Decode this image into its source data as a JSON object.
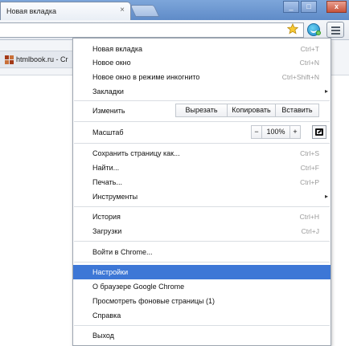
{
  "tab": {
    "title": "Новая вкладка",
    "close_glyph": "×"
  },
  "window_controls": {
    "minimize": "_",
    "maximize": "□",
    "close": "x"
  },
  "icons": {
    "star": "star-icon",
    "extension": "skype-extension-icon",
    "menu": "hamburger-menu-icon",
    "fullscreen": "fullscreen-icon",
    "submenu": "chevron-right-icon"
  },
  "bookmarks": [
    {
      "label": "htmlbook.ru - Cr"
    }
  ],
  "menu": {
    "new_tab": {
      "label": "Новая вкладка",
      "shortcut": "Ctrl+T"
    },
    "new_window": {
      "label": "Новое окно",
      "shortcut": "Ctrl+N"
    },
    "incognito": {
      "label": "Новое окно в режиме инкогнито",
      "shortcut": "Ctrl+Shift+N"
    },
    "bookmarks": {
      "label": "Закладки",
      "arrow": "▸"
    },
    "edit": {
      "label": "Изменить",
      "cut": "Вырезать",
      "copy": "Копировать",
      "paste": "Вставить"
    },
    "zoom": {
      "label": "Масштаб",
      "minus": "−",
      "value": "100%",
      "plus": "+"
    },
    "save_page": {
      "label": "Сохранить страницу как...",
      "shortcut": "Ctrl+S"
    },
    "find": {
      "label": "Найти...",
      "shortcut": "Ctrl+F"
    },
    "print": {
      "label": "Печать...",
      "shortcut": "Ctrl+P"
    },
    "tools": {
      "label": "Инструменты",
      "arrow": "▸"
    },
    "history": {
      "label": "История",
      "shortcut": "Ctrl+H"
    },
    "downloads": {
      "label": "Загрузки",
      "shortcut": "Ctrl+J"
    },
    "signin": {
      "label": "Войти в Chrome..."
    },
    "settings": {
      "label": "Настройки"
    },
    "about": {
      "label": "О браузере Google Chrome"
    },
    "background_pages": {
      "label": "Просмотреть фоновые страницы (1)"
    },
    "help": {
      "label": "Справка"
    },
    "exit": {
      "label": "Выход"
    }
  },
  "colors": {
    "highlight": "#3d77d6",
    "shortcut_text": "#9a9a9a",
    "favicon": "#a33a18"
  }
}
